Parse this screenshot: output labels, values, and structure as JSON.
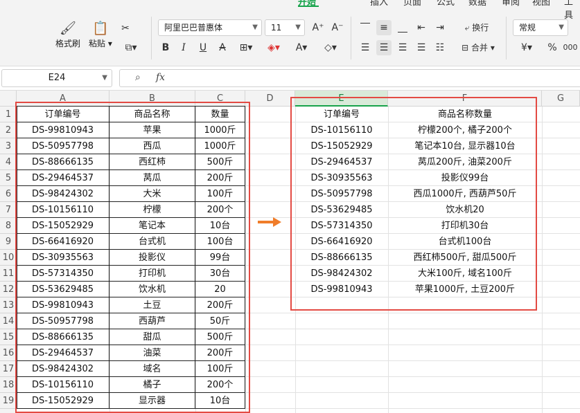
{
  "ribbon": {
    "tabs": [
      "开始",
      "插入",
      "页面",
      "公式",
      "数据",
      "审阅",
      "视图",
      "工具"
    ],
    "active_tab": "开始",
    "format_painter": "格式刷",
    "paste": "粘贴",
    "font_name": "阿里巴巴普惠体",
    "font_size": "11",
    "wrap_text": "换行",
    "merge": "合并",
    "number_format": "常规"
  },
  "formula_bar": {
    "cell_ref": "E24",
    "fx": "fx",
    "value": ""
  },
  "columns": [
    "A",
    "B",
    "C",
    "D",
    "E",
    "F",
    "G"
  ],
  "rows": [
    "1",
    "2",
    "3",
    "4",
    "5",
    "6",
    "7",
    "8",
    "9",
    "10",
    "11",
    "12",
    "13",
    "14",
    "15",
    "16",
    "17",
    "18",
    "19"
  ],
  "left_table": {
    "headers": [
      "订单编号",
      "商品名称",
      "数量"
    ],
    "rows": [
      [
        "DS-99810943",
        "苹果",
        "1000斤"
      ],
      [
        "DS-50957798",
        "西瓜",
        "1000斤"
      ],
      [
        "DS-88666135",
        "西红柿",
        "500斤"
      ],
      [
        "DS-29464537",
        "莴瓜",
        "200斤"
      ],
      [
        "DS-98424302",
        "大米",
        "100斤"
      ],
      [
        "DS-10156110",
        "柠檬",
        "200个"
      ],
      [
        "DS-15052929",
        "笔记本",
        "10台"
      ],
      [
        "DS-66416920",
        "台式机",
        "100台"
      ],
      [
        "DS-30935563",
        "投影仪",
        "99台"
      ],
      [
        "DS-57314350",
        "打印机",
        "30台"
      ],
      [
        "DS-53629485",
        "饮水机",
        "20"
      ],
      [
        "DS-99810943",
        "土豆",
        "200斤"
      ],
      [
        "DS-50957798",
        "西葫芦",
        "50斤"
      ],
      [
        "DS-88666135",
        "甜瓜",
        "500斤"
      ],
      [
        "DS-29464537",
        "油菜",
        "200斤"
      ],
      [
        "DS-98424302",
        "域名",
        "100斤"
      ],
      [
        "DS-10156110",
        "橘子",
        "200个"
      ],
      [
        "DS-15052929",
        "显示器",
        "10台"
      ]
    ]
  },
  "right_table": {
    "headers": [
      "订单编号",
      "商品名称数量"
    ],
    "rows": [
      [
        "DS-10156110",
        "柠檬200个, 橘子200个"
      ],
      [
        "DS-15052929",
        "笔记本10台, 显示器10台"
      ],
      [
        "DS-29464537",
        "莴瓜200斤, 油菜200斤"
      ],
      [
        "DS-30935563",
        "投影仪99台"
      ],
      [
        "DS-50957798",
        "西瓜1000斤, 西葫芦50斤"
      ],
      [
        "DS-53629485",
        "饮水机20"
      ],
      [
        "DS-57314350",
        "打印机30台"
      ],
      [
        "DS-66416920",
        "台式机100台"
      ],
      [
        "DS-88666135",
        "西红柿500斤, 甜瓜500斤"
      ],
      [
        "DS-98424302",
        "大米100斤, 域名100斤"
      ],
      [
        "DS-99810943",
        "苹果1000斤, 土豆200斤"
      ]
    ]
  },
  "colors": {
    "accent": "#16a34a",
    "highlight_box": "#e34a43",
    "arrow": "#f07d2a"
  }
}
